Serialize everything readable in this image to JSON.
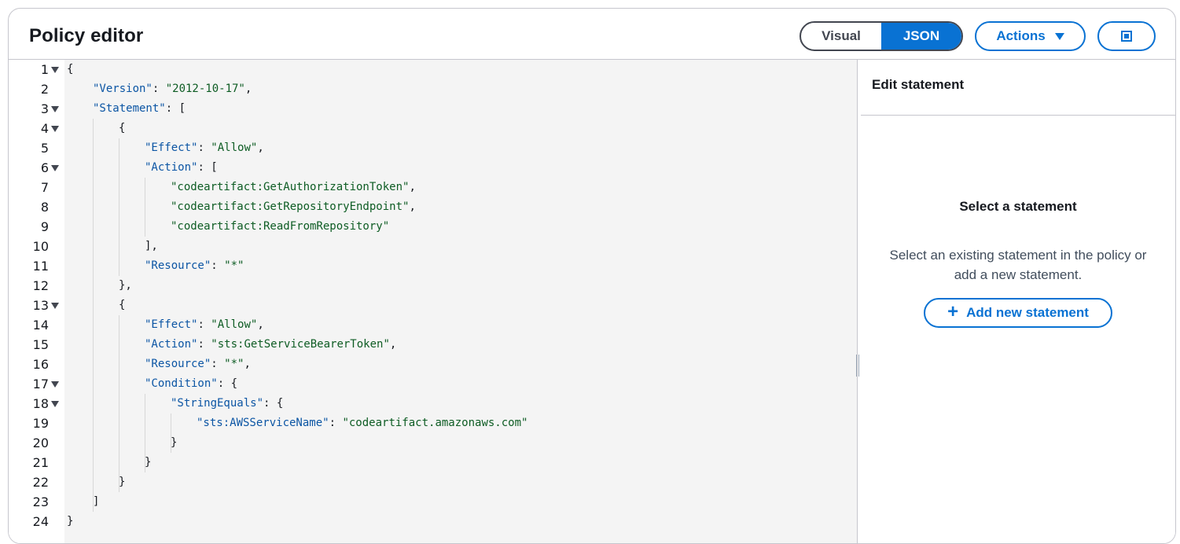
{
  "header": {
    "title": "Policy editor",
    "mode_toggle": {
      "options": [
        "Visual",
        "JSON"
      ],
      "selected": "JSON"
    },
    "actions_label": "Actions"
  },
  "editor": {
    "lines": [
      {
        "n": "1",
        "fold": true
      },
      {
        "n": "2",
        "fold": false
      },
      {
        "n": "3",
        "fold": true
      },
      {
        "n": "4",
        "fold": true
      },
      {
        "n": "5",
        "fold": false
      },
      {
        "n": "6",
        "fold": true
      },
      {
        "n": "7",
        "fold": false
      },
      {
        "n": "8",
        "fold": false
      },
      {
        "n": "9",
        "fold": false
      },
      {
        "n": "10",
        "fold": false
      },
      {
        "n": "11",
        "fold": false
      },
      {
        "n": "12",
        "fold": false
      },
      {
        "n": "13",
        "fold": true
      },
      {
        "n": "14",
        "fold": false
      },
      {
        "n": "15",
        "fold": false
      },
      {
        "n": "16",
        "fold": false
      },
      {
        "n": "17",
        "fold": true
      },
      {
        "n": "18",
        "fold": true
      },
      {
        "n": "19",
        "fold": false
      },
      {
        "n": "20",
        "fold": false
      },
      {
        "n": "21",
        "fold": false
      },
      {
        "n": "22",
        "fold": false
      },
      {
        "n": "23",
        "fold": false
      },
      {
        "n": "24",
        "fold": false
      }
    ],
    "tokens": {
      "l1": "{",
      "l2_key": "\"Version\"",
      "l2_sep": ": ",
      "l2_val": "\"2012-10-17\"",
      "l2_end": ",",
      "l3_key": "\"Statement\"",
      "l3_rest": ": [",
      "l4": "{",
      "l5_key": "\"Effect\"",
      "l5_sep": ": ",
      "l5_val": "\"Allow\"",
      "l5_end": ",",
      "l6_key": "\"Action\"",
      "l6_rest": ": [",
      "l7_val": "\"codeartifact:GetAuthorizationToken\"",
      "l7_end": ",",
      "l8_val": "\"codeartifact:GetRepositoryEndpoint\"",
      "l8_end": ",",
      "l9_val": "\"codeartifact:ReadFromRepository\"",
      "l10": "],",
      "l11_key": "\"Resource\"",
      "l11_sep": ": ",
      "l11_val": "\"*\"",
      "l12": "},",
      "l13": "{",
      "l14_key": "\"Effect\"",
      "l14_sep": ": ",
      "l14_val": "\"Allow\"",
      "l14_end": ",",
      "l15_key": "\"Action\"",
      "l15_sep": ": ",
      "l15_val": "\"sts:GetServiceBearerToken\"",
      "l15_end": ",",
      "l16_key": "\"Resource\"",
      "l16_sep": ": ",
      "l16_val": "\"*\"",
      "l16_end": ",",
      "l17_key": "\"Condition\"",
      "l17_rest": ": {",
      "l18_key": "\"StringEquals\"",
      "l18_rest": ": {",
      "l19_key": "\"sts:AWSServiceName\"",
      "l19_sep": ": ",
      "l19_val": "\"codeartifact.amazonaws.com\"",
      "l20": "}",
      "l21": "}",
      "l22": "}",
      "l23": "]",
      "l24": "}"
    }
  },
  "side_panel": {
    "header": "Edit statement",
    "empty_title": "Select a statement",
    "empty_description": "Select an existing statement in the policy or add a new statement.",
    "add_button_label": "Add new statement",
    "add_button_icon": "plus-icon"
  },
  "colors": {
    "accent": "#0972d3",
    "json_key": "#0b55a4",
    "json_string": "#0d5c23",
    "editor_bg": "#f4f4f4"
  }
}
